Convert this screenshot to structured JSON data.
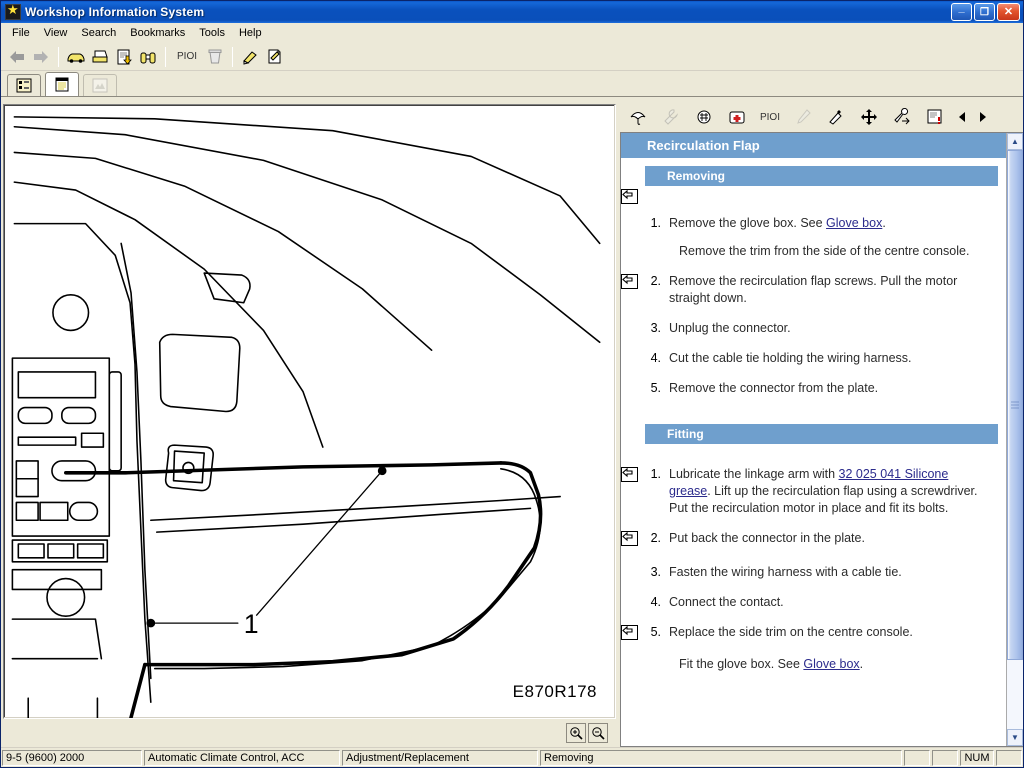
{
  "window": {
    "title": "Workshop Information System",
    "icon": "star-app-icon",
    "buttons": {
      "minimize": "minimize-button",
      "maximize": "maximize-button",
      "close": "close-button"
    }
  },
  "menubar": {
    "items": [
      "File",
      "View",
      "Search",
      "Bookmarks",
      "Tools",
      "Help"
    ]
  },
  "toolbar": {
    "items": [
      {
        "name": "back-icon",
        "glyph": "←",
        "label": ""
      },
      {
        "name": "forward-icon",
        "glyph": "→",
        "label": ""
      },
      {
        "name": "vehicle-icon",
        "glyph": "⛟",
        "label": ""
      },
      {
        "name": "print-icon",
        "glyph": "⎙",
        "label": ""
      },
      {
        "name": "download-doc-icon",
        "glyph": "⬇",
        "label": ""
      },
      {
        "name": "binoculars-icon",
        "glyph": "ὐD",
        "label": ""
      },
      {
        "name": "pioi-button",
        "glyph": "",
        "label": "PIOI"
      },
      {
        "name": "trash-icon",
        "glyph": "Ὕ1",
        "label": ""
      },
      {
        "name": "highlighter-icon",
        "glyph": "✎",
        "label": ""
      },
      {
        "name": "annotate-icon",
        "glyph": "✍",
        "label": ""
      }
    ]
  },
  "subtabs": {
    "items": [
      {
        "name": "tab-tree-view",
        "state": "inactive"
      },
      {
        "name": "tab-document-view",
        "state": "active"
      },
      {
        "name": "tab-image-view",
        "state": "disabled"
      }
    ]
  },
  "right_toolbar": {
    "items": [
      {
        "name": "umbrella-icon",
        "glyph": "☂",
        "label": "",
        "state": "enabled"
      },
      {
        "name": "wrench-icon",
        "glyph": "ὒ7",
        "label": "",
        "state": "disabled"
      },
      {
        "name": "engine-icon",
        "glyph": "⚙",
        "label": "",
        "state": "enabled"
      },
      {
        "name": "first-aid-icon",
        "glyph": "✚",
        "label": "",
        "state": "enabled"
      },
      {
        "name": "pioi-button",
        "glyph": "",
        "label": "PIOI",
        "state": "enabled"
      },
      {
        "name": "screwdriver-icon",
        "glyph": "ὒ9",
        "label": "",
        "state": "disabled"
      },
      {
        "name": "tools-icon",
        "glyph": "⚒",
        "label": "",
        "state": "enabled"
      },
      {
        "name": "move-icon",
        "glyph": "✥",
        "label": "",
        "state": "enabled"
      },
      {
        "name": "hand-tool-icon",
        "glyph": "☞",
        "label": "",
        "state": "enabled"
      },
      {
        "name": "note-alert-icon",
        "glyph": "❗",
        "label": "",
        "state": "enabled"
      },
      {
        "name": "prev-arrow-icon",
        "glyph": "◀",
        "label": "",
        "state": "enabled"
      },
      {
        "name": "next-arrow-icon",
        "glyph": "▶",
        "label": "",
        "state": "enabled"
      }
    ]
  },
  "document": {
    "title": "Recirculation Flap",
    "sections": [
      {
        "heading": "Removing",
        "steps": [
          {
            "num": "1.",
            "flag": false,
            "text_parts": [
              {
                "t": "Remove the glove box. See "
              },
              {
                "t": "Glove box",
                "link": true
              },
              {
                "t": "."
              }
            ]
          },
          {
            "num": "",
            "flag": false,
            "subpara": true,
            "text_parts": [
              {
                "t": "Remove the trim from the side of the centre console."
              }
            ]
          },
          {
            "num": "2.",
            "flag": true,
            "text_parts": [
              {
                "t": "Remove the recirculation flap screws. Pull the motor straight down."
              }
            ]
          },
          {
            "num": "3.",
            "flag": false,
            "text_parts": [
              {
                "t": "Unplug the connector."
              }
            ]
          },
          {
            "num": "4.",
            "flag": false,
            "text_parts": [
              {
                "t": "Cut the cable tie holding the wiring harness."
              }
            ]
          },
          {
            "num": "5.",
            "flag": false,
            "text_parts": [
              {
                "t": "Remove the connector from the plate."
              }
            ]
          }
        ]
      },
      {
        "heading": "Fitting",
        "steps": [
          {
            "num": "1.",
            "flag": true,
            "text_parts": [
              {
                "t": "Lubricate the linkage arm with "
              },
              {
                "t": "32 025 041 Silicone grease",
                "link": true
              },
              {
                "t": ". Lift up the recirculation flap using a screwdriver. Put the recirculation motor in place and fit its bolts."
              }
            ]
          },
          {
            "num": "2.",
            "flag": true,
            "text_parts": [
              {
                "t": "Put back the connector in the plate."
              }
            ]
          },
          {
            "num": "3.",
            "flag": false,
            "text_parts": [
              {
                "t": "Fasten the wiring harness with a cable tie."
              }
            ]
          },
          {
            "num": "4.",
            "flag": false,
            "text_parts": [
              {
                "t": "Connect the contact."
              }
            ]
          },
          {
            "num": "5.",
            "flag": true,
            "text_parts": [
              {
                "t": "Replace the side trim on the centre console."
              }
            ]
          },
          {
            "num": "",
            "flag": false,
            "subpara": true,
            "text_parts": [
              {
                "t": "Fit the glove box. See "
              },
              {
                "t": "Glove box",
                "link": true
              },
              {
                "t": "."
              }
            ]
          }
        ]
      }
    ]
  },
  "diagram": {
    "code": "E870R178",
    "callouts": [
      {
        "label": "1"
      }
    ],
    "zoom_in": "zoom-in-icon",
    "zoom_out": "zoom-out-icon"
  },
  "statusbar": {
    "model": "9-5 (9600) 2000",
    "system": "Automatic Climate Control, ACC",
    "category": "Adjustment/Replacement",
    "operation": "Removing",
    "num_lock": "NUM"
  },
  "colors": {
    "title_gradient_start": "#1567d8",
    "title_gradient_end": "#0a4fba",
    "heading_blue": "#6f9fcd",
    "link_blue": "#2b2b8c",
    "chrome": "#ece9d8",
    "accent_yellow": "#ffe33a"
  }
}
